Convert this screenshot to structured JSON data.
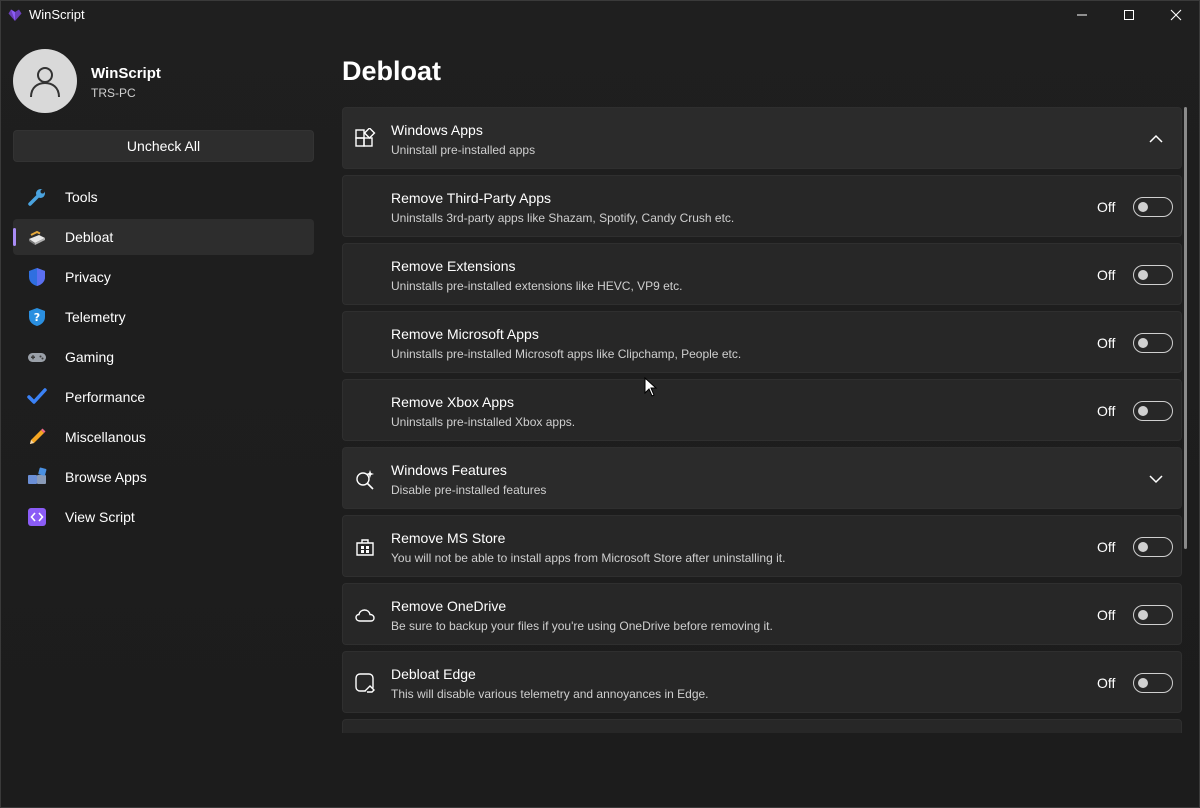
{
  "window": {
    "title": "WinScript"
  },
  "user": {
    "name": "WinScript",
    "host": "TRS-PC"
  },
  "sidebar": {
    "uncheck_all_label": "Uncheck All",
    "items": [
      {
        "label": "Tools",
        "icon": "wrench-icon"
      },
      {
        "label": "Debloat",
        "icon": "broom-icon",
        "active": true
      },
      {
        "label": "Privacy",
        "icon": "shield-icon"
      },
      {
        "label": "Telemetry",
        "icon": "shield-question-icon"
      },
      {
        "label": "Gaming",
        "icon": "gamepad-icon"
      },
      {
        "label": "Performance",
        "icon": "checkmark-icon"
      },
      {
        "label": "Miscellanous",
        "icon": "pencil-icon"
      },
      {
        "label": "Browse Apps",
        "icon": "apps-icon"
      },
      {
        "label": "View Script",
        "icon": "code-icon"
      }
    ]
  },
  "main": {
    "title": "Debloat",
    "cards": [
      {
        "kind": "group",
        "title": "Windows Apps",
        "desc": "Uninstall pre-installed apps",
        "icon": "apps-grid-icon",
        "expanded": true
      },
      {
        "kind": "option",
        "title": "Remove Third-Party Apps",
        "desc": "Uninstalls 3rd-party apps like Shazam, Spotify, Candy Crush etc.",
        "state": "Off"
      },
      {
        "kind": "option",
        "title": "Remove Extensions",
        "desc": "Uninstalls pre-installed extensions like HEVC, VP9 etc.",
        "state": "Off"
      },
      {
        "kind": "option",
        "title": "Remove Microsoft Apps",
        "desc": "Uninstalls pre-installed Microsoft apps like Clipchamp, People etc.",
        "state": "Off"
      },
      {
        "kind": "option",
        "title": "Remove Xbox Apps",
        "desc": "Uninstalls pre-installed Xbox apps.",
        "state": "Off"
      },
      {
        "kind": "group",
        "title": "Windows Features",
        "desc": "Disable pre-installed features",
        "icon": "sparkle-search-icon",
        "expanded": false
      },
      {
        "kind": "option",
        "title": "Remove MS Store",
        "desc": "You will not be able to install apps from Microsoft Store after uninstalling it.",
        "state": "Off",
        "icon": "store-icon"
      },
      {
        "kind": "option",
        "title": "Remove OneDrive",
        "desc": "Be sure to backup your files if you're using OneDrive before removing it.",
        "state": "Off",
        "icon": "cloud-icon"
      },
      {
        "kind": "option",
        "title": "Debloat Edge",
        "desc": "This will disable various telemetry and annoyances in Edge.",
        "state": "Off",
        "icon": "edge-eraser-icon"
      }
    ]
  },
  "colors": {
    "accent": "#a98cf5",
    "background": "#202020",
    "card": "#2b2b2b"
  }
}
